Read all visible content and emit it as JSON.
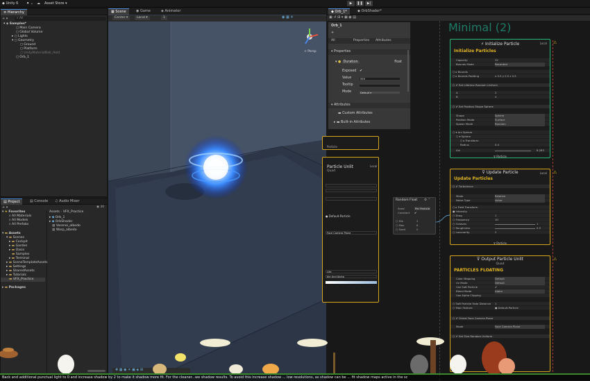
{
  "topbar": {
    "unity": "Unity 6",
    "asset_store": "Asset Store ▾",
    "account": "⚫ ⌄",
    "cloud": "☁"
  },
  "hierarchy": {
    "tab": "Hierarchy",
    "search": "All",
    "items": [
      "Samples*",
      "Main Camera",
      "Global Volume",
      "Lights",
      "Geometry",
      "Ground",
      "Platform",
      "UnityMaterialBall_Hold",
      "Orb_1"
    ]
  },
  "project": {
    "tabs": [
      "Project",
      "Console",
      "Audio Mixer"
    ],
    "breadcrumb": [
      "Assets",
      "VFX_Practice"
    ],
    "count": "30",
    "favorites": {
      "title": "Favorites",
      "items": [
        "All Materials",
        "All Models",
        "All Prefabs"
      ]
    },
    "tree": {
      "title": "Assets",
      "items": [
        "Scenes",
        "Cockpit",
        "Garden",
        "Oasis",
        "Samples",
        "Terminal",
        "SceneTemplateAssets",
        "Settings",
        "SharedAssets",
        "Tutorials",
        "VFX_Practice",
        "Packages"
      ]
    },
    "files": [
      "Orb_1",
      "OrbShader",
      "Voronoi_albedo",
      "Warp_albedo"
    ]
  },
  "scene": {
    "tabs": [
      "Scene",
      "Game",
      "Animator"
    ],
    "pivot": "Center ▾",
    "space": "Local ▾",
    "snap": "1",
    "persp": "< Persp"
  },
  "vfx": {
    "tabs": [
      "Orb_1*",
      "OrbShader*"
    ],
    "asset_title": "Orb_1",
    "subtabs": [
      "All",
      "Properties",
      "Attributes"
    ],
    "properties_title": "Properties",
    "property": {
      "name": "Duration",
      "type": "float",
      "exposed_label": "Exposed",
      "value_label": "Value",
      "value": "999",
      "tooltip_label": "Tooltip",
      "mode_label": "Mode",
      "mode": "Default"
    },
    "attributes_title": "Attributes",
    "custom_attr": "Custom Attributes",
    "builtin_attr": "Built-in Attributes"
  },
  "graph": {
    "title": "Minimal (2)",
    "init": {
      "header": "Initialize Particle",
      "title": "Initialize Particles",
      "local": "Local",
      "rows": [
        [
          "Capacity",
          "32"
        ],
        [
          "Bounds Mode",
          "Recorded"
        ],
        [
          "Bounds",
          ""
        ],
        [
          "Bounds Padding",
          "x 0.5   y 0.5   z 0.5"
        ]
      ],
      "set_lifetime": "Set  Lifetime  Random Uniform",
      "lifetime": [
        [
          "A",
          "2"
        ],
        [
          "B",
          "4"
        ]
      ],
      "set_position": "Set  Position Shape  Sphere",
      "position": [
        [
          "Shape",
          "Sphere"
        ],
        [
          "Position Mode",
          "Surface"
        ],
        [
          "Spawn Mode",
          "Random"
        ],
        [
          "Arc Sphere",
          ""
        ],
        [
          "Sphere",
          ""
        ],
        [
          "Transform",
          ""
        ],
        [
          "Radius",
          "0.4"
        ],
        [
          "Arc",
          "6.283"
        ]
      ],
      "footer": "Particle"
    },
    "update": {
      "header": "Update Particle",
      "title": "Update Particles",
      "local": "Local",
      "turbulence": "Turbulence",
      "rows": [
        [
          "Mode",
          "Relative"
        ],
        [
          "Noise Type",
          "Value"
        ],
        [
          "Field Transform",
          ""
        ],
        [
          "Intensity",
          ""
        ],
        [
          "Drag",
          "1"
        ],
        [
          "Frequency",
          "10"
        ],
        [
          "Octaves",
          "1"
        ],
        [
          "Roughness",
          "0.5"
        ],
        [
          "Lacunarity",
          "2"
        ]
      ],
      "footer": "Particle"
    },
    "output": {
      "header": "Output Particle Unlit",
      "subheader": "Quad",
      "title": "PARTICLES FLOATING",
      "rows": [
        [
          "Color Mapping",
          "Default"
        ],
        [
          "Uv Mode",
          "Default"
        ],
        [
          "Use Soft Particle",
          ""
        ],
        [
          "Blend Mode",
          "Alpha"
        ],
        [
          "Use Alpha Clipping",
          ""
        ],
        [
          "Soft Particle Fade Distance",
          "1"
        ],
        [
          "Main Texture",
          "● Default-Particle"
        ]
      ],
      "orient": "Orient  Face Camera Plane",
      "orient_mode": [
        "Mode",
        "Face Camera Plane"
      ],
      "set_size": "Set  Size  Random Uniform"
    },
    "random": {
      "title": "Random  Float",
      "seed": "Seed",
      "seed_val": "Per Particle",
      "constant": "Constant",
      "rows": [
        [
          "Min",
          "2"
        ],
        [
          "Max",
          "6"
        ],
        [
          "Seed",
          "0"
        ]
      ]
    },
    "left_block": {
      "header": "Particle Unlit",
      "subheader": "Quad",
      "local": "Local",
      "texture": "Default-Particle",
      "mode": "Face Camera Plane",
      "rows": [
        "Life",
        "ble And Alpha"
      ],
      "particle": "Particle"
    }
  },
  "subtitle": "Back and additional punctual light to 0 and increase shadow by 2 to make it shadow more fit. For the cleaner...we shadow results. To avoid this increase shadow ... low resolutions, as shadow can be ... fit shadow maps active in the sc"
}
